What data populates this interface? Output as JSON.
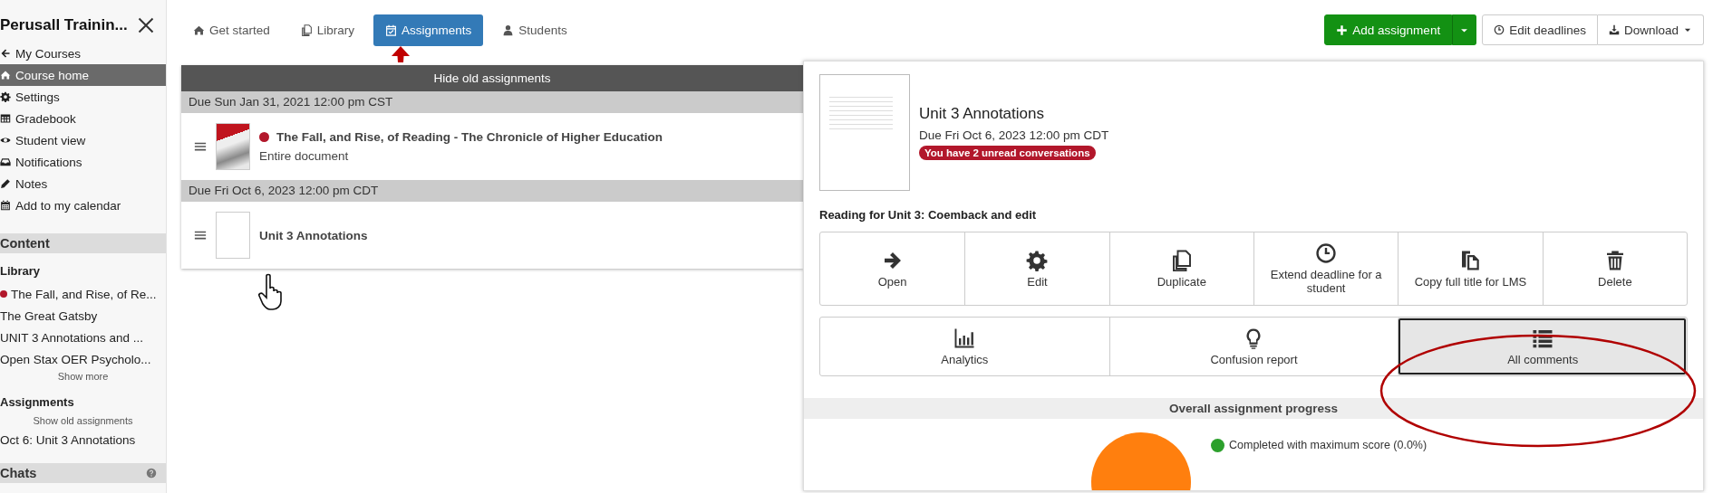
{
  "sidebar": {
    "title": "Perusall Trainin...",
    "nav_items": [
      {
        "label": "My Courses",
        "selected": false
      },
      {
        "label": "Course home",
        "selected": true
      },
      {
        "label": "Settings",
        "selected": false
      },
      {
        "label": "Gradebook",
        "selected": false
      },
      {
        "label": "Student view",
        "selected": false
      },
      {
        "label": "Notifications",
        "selected": false
      },
      {
        "label": "Notes",
        "selected": false
      },
      {
        "label": "Add to my calendar",
        "selected": false
      }
    ],
    "content_header": "Content",
    "library": {
      "heading": "Library",
      "items": [
        {
          "label": "The Fall, and Rise, of Re...",
          "unread": true
        },
        {
          "label": "The Great Gatsby",
          "unread": false
        },
        {
          "label": "UNIT 3 Annotations and ...",
          "unread": false
        },
        {
          "label": "Open Stax OER Psycholo...",
          "unread": false
        }
      ],
      "show_more": "Show more"
    },
    "assignments": {
      "heading": "Assignments",
      "show_old": "Show old assignments",
      "items": [
        "Oct 6: Unit 3 Annotations"
      ]
    },
    "chats_header": "Chats"
  },
  "tabs": [
    {
      "label": "Get started",
      "selected": false
    },
    {
      "label": "Library",
      "selected": false
    },
    {
      "label": "Assignments",
      "selected": true
    },
    {
      "label": "Students",
      "selected": false
    }
  ],
  "toolbar": {
    "add_assignment": "Add assignment",
    "edit_deadlines": "Edit deadlines",
    "download": "Download"
  },
  "assignment_list": {
    "toggle": "Hide old assignments",
    "groups": [
      {
        "due": "Due Sun Jan 31, 2021 12:00 pm CST",
        "items": [
          {
            "title": "The Fall, and Rise, of Reading - The Chronicle of Higher Education",
            "subtitle": "Entire document",
            "unread": true
          }
        ]
      },
      {
        "due": "Due Fri Oct 6, 2023 12:00 pm CDT",
        "items": [
          {
            "title": "Unit 3 Annotations",
            "unread": false
          }
        ]
      }
    ]
  },
  "detail": {
    "title": "Unit 3 Annotations",
    "due": "Due Fri Oct 6, 2023 12:00 pm CDT",
    "badge": "You have 2 unread conversations",
    "reading": "Reading for Unit 3: Coemback and edit",
    "actions": [
      {
        "label": "Open"
      },
      {
        "label": "Edit"
      },
      {
        "label": "Duplicate"
      },
      {
        "label": "Extend deadline for a student"
      },
      {
        "label": "Copy full title for LMS"
      },
      {
        "label": "Delete"
      }
    ],
    "views": [
      {
        "label": "Analytics",
        "selected": false
      },
      {
        "label": "Confusion report",
        "selected": false
      },
      {
        "label": "All comments",
        "selected": true
      }
    ],
    "progress": {
      "heading": "Overall assignment progress",
      "legend": [
        {
          "label": "Completed with maximum score (0.0%)",
          "color": "#2ca02c"
        }
      ]
    }
  }
}
